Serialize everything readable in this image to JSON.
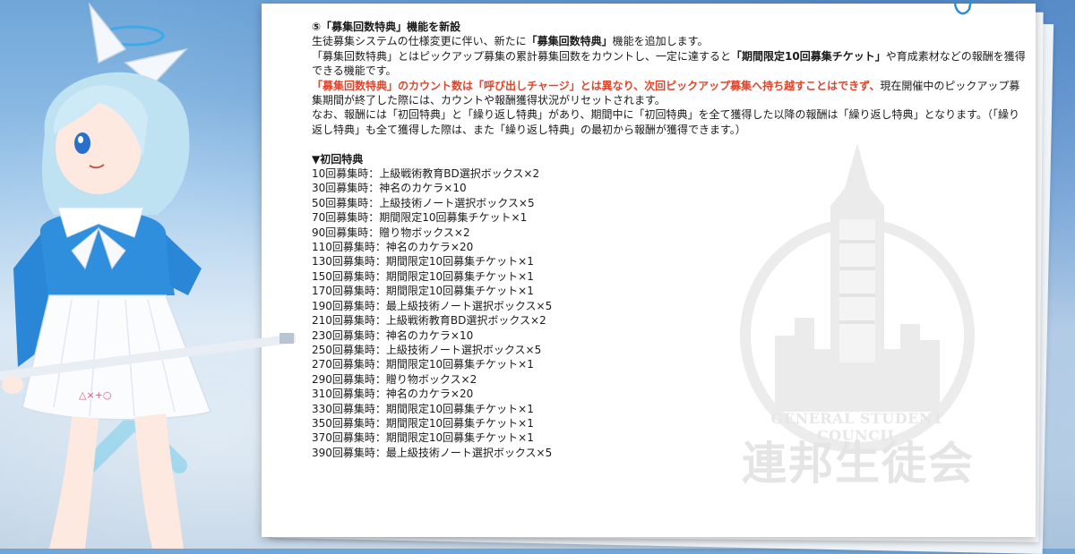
{
  "section": {
    "heading": "⑤「募集回数特典」機能を新設"
  },
  "paragraphs": {
    "p1_a": "生徒募集システムの仕様変更に伴い、新たに",
    "p1_b": "「募集回数特典」",
    "p1_c": "機能を追加します。",
    "p2_a": "「募集回数特典」とはピックアップ募集の累計募集回数をカウントし、一定に達すると",
    "p2_b": "「期間限定10回募集チケット」",
    "p2_c": "や育成素材などの報酬を獲得できる機能です。",
    "p3_a": "「募集回数特典」のカウント数は「呼び出しチャージ」とは異なり、次回ピックアップ募集へ持ち越すことはできず、",
    "p3_b": "現在開催中のピックアップ募集期間が終了した際には、カウントや報酬獲得状況がリセットされます。",
    "p4": "なお、報酬には「初回特典」と「繰り返し特典」があり、期間中に「初回特典」を全て獲得した以降の報酬は「繰り返し特典」となります。（「繰り返し特典」も全て獲得した際は、また「繰り返し特典」の最初から報酬が獲得できます。）"
  },
  "rewards": {
    "heading": "▼初回特典",
    "items": [
      "10回募集時：上級戦術教育BD選択ボックス×2",
      "30回募集時：神名のカケラ×10",
      "50回募集時：上級技術ノート選択ボックス×5",
      "70回募集時：期間限定10回募集チケット×1",
      "90回募集時：贈り物ボックス×2",
      "110回募集時：神名のカケラ×20",
      "130回募集時：期間限定10回募集チケット×1",
      "150回募集時：期間限定10回募集チケット×1",
      "170回募集時：期間限定10回募集チケット×1",
      "190回募集時：最上級技術ノート選択ボックス×5",
      "210回募集時：上級戦術教育BD選択ボックス×2",
      "230回募集時：神名のカケラ×10",
      "250回募集時：上級技術ノート選択ボックス×5",
      "270回募集時：期間限定10回募集チケット×1",
      "290回募集時：贈り物ボックス×2",
      "310回募集時：神名のカケラ×20",
      "330回募集時：期間限定10回募集チケット×1",
      "350回募集時：期間限定10回募集チケット×1",
      "370回募集時：期間限定10回募集チケット×1",
      "390回募集時：最上級技術ノート選択ボックス×5"
    ]
  },
  "watermark": {
    "english": "GENERAL STUDENT COUNCIL",
    "japanese": "連邦生徒会"
  },
  "skirt_symbols": "△×+○",
  "colors": {
    "emphasis_red": "#e0452b",
    "text": "#1a1a1a",
    "watermark": "#e5e5e5"
  },
  "icons": {
    "character": "character-illustration",
    "emblem": "general-student-council-emblem",
    "clip": "paper-clip-icon"
  }
}
